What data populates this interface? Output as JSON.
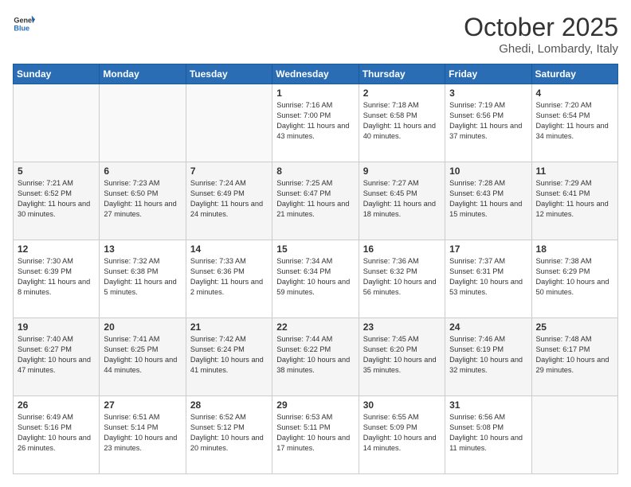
{
  "logo": {
    "general": "General",
    "blue": "Blue"
  },
  "header": {
    "month": "October 2025",
    "location": "Ghedi, Lombardy, Italy"
  },
  "weekdays": [
    "Sunday",
    "Monday",
    "Tuesday",
    "Wednesday",
    "Thursday",
    "Friday",
    "Saturday"
  ],
  "weeks": [
    [
      {
        "day": "",
        "sunrise": "",
        "sunset": "",
        "daylight": "",
        "empty": true
      },
      {
        "day": "",
        "sunrise": "",
        "sunset": "",
        "daylight": "",
        "empty": true
      },
      {
        "day": "",
        "sunrise": "",
        "sunset": "",
        "daylight": "",
        "empty": true
      },
      {
        "day": "1",
        "sunrise": "Sunrise: 7:16 AM",
        "sunset": "Sunset: 7:00 PM",
        "daylight": "Daylight: 11 hours and 43 minutes.",
        "empty": false
      },
      {
        "day": "2",
        "sunrise": "Sunrise: 7:18 AM",
        "sunset": "Sunset: 6:58 PM",
        "daylight": "Daylight: 11 hours and 40 minutes.",
        "empty": false
      },
      {
        "day": "3",
        "sunrise": "Sunrise: 7:19 AM",
        "sunset": "Sunset: 6:56 PM",
        "daylight": "Daylight: 11 hours and 37 minutes.",
        "empty": false
      },
      {
        "day": "4",
        "sunrise": "Sunrise: 7:20 AM",
        "sunset": "Sunset: 6:54 PM",
        "daylight": "Daylight: 11 hours and 34 minutes.",
        "empty": false
      }
    ],
    [
      {
        "day": "5",
        "sunrise": "Sunrise: 7:21 AM",
        "sunset": "Sunset: 6:52 PM",
        "daylight": "Daylight: 11 hours and 30 minutes.",
        "empty": false
      },
      {
        "day": "6",
        "sunrise": "Sunrise: 7:23 AM",
        "sunset": "Sunset: 6:50 PM",
        "daylight": "Daylight: 11 hours and 27 minutes.",
        "empty": false
      },
      {
        "day": "7",
        "sunrise": "Sunrise: 7:24 AM",
        "sunset": "Sunset: 6:49 PM",
        "daylight": "Daylight: 11 hours and 24 minutes.",
        "empty": false
      },
      {
        "day": "8",
        "sunrise": "Sunrise: 7:25 AM",
        "sunset": "Sunset: 6:47 PM",
        "daylight": "Daylight: 11 hours and 21 minutes.",
        "empty": false
      },
      {
        "day": "9",
        "sunrise": "Sunrise: 7:27 AM",
        "sunset": "Sunset: 6:45 PM",
        "daylight": "Daylight: 11 hours and 18 minutes.",
        "empty": false
      },
      {
        "day": "10",
        "sunrise": "Sunrise: 7:28 AM",
        "sunset": "Sunset: 6:43 PM",
        "daylight": "Daylight: 11 hours and 15 minutes.",
        "empty": false
      },
      {
        "day": "11",
        "sunrise": "Sunrise: 7:29 AM",
        "sunset": "Sunset: 6:41 PM",
        "daylight": "Daylight: 11 hours and 12 minutes.",
        "empty": false
      }
    ],
    [
      {
        "day": "12",
        "sunrise": "Sunrise: 7:30 AM",
        "sunset": "Sunset: 6:39 PM",
        "daylight": "Daylight: 11 hours and 8 minutes.",
        "empty": false
      },
      {
        "day": "13",
        "sunrise": "Sunrise: 7:32 AM",
        "sunset": "Sunset: 6:38 PM",
        "daylight": "Daylight: 11 hours and 5 minutes.",
        "empty": false
      },
      {
        "day": "14",
        "sunrise": "Sunrise: 7:33 AM",
        "sunset": "Sunset: 6:36 PM",
        "daylight": "Daylight: 11 hours and 2 minutes.",
        "empty": false
      },
      {
        "day": "15",
        "sunrise": "Sunrise: 7:34 AM",
        "sunset": "Sunset: 6:34 PM",
        "daylight": "Daylight: 10 hours and 59 minutes.",
        "empty": false
      },
      {
        "day": "16",
        "sunrise": "Sunrise: 7:36 AM",
        "sunset": "Sunset: 6:32 PM",
        "daylight": "Daylight: 10 hours and 56 minutes.",
        "empty": false
      },
      {
        "day": "17",
        "sunrise": "Sunrise: 7:37 AM",
        "sunset": "Sunset: 6:31 PM",
        "daylight": "Daylight: 10 hours and 53 minutes.",
        "empty": false
      },
      {
        "day": "18",
        "sunrise": "Sunrise: 7:38 AM",
        "sunset": "Sunset: 6:29 PM",
        "daylight": "Daylight: 10 hours and 50 minutes.",
        "empty": false
      }
    ],
    [
      {
        "day": "19",
        "sunrise": "Sunrise: 7:40 AM",
        "sunset": "Sunset: 6:27 PM",
        "daylight": "Daylight: 10 hours and 47 minutes.",
        "empty": false
      },
      {
        "day": "20",
        "sunrise": "Sunrise: 7:41 AM",
        "sunset": "Sunset: 6:25 PM",
        "daylight": "Daylight: 10 hours and 44 minutes.",
        "empty": false
      },
      {
        "day": "21",
        "sunrise": "Sunrise: 7:42 AM",
        "sunset": "Sunset: 6:24 PM",
        "daylight": "Daylight: 10 hours and 41 minutes.",
        "empty": false
      },
      {
        "day": "22",
        "sunrise": "Sunrise: 7:44 AM",
        "sunset": "Sunset: 6:22 PM",
        "daylight": "Daylight: 10 hours and 38 minutes.",
        "empty": false
      },
      {
        "day": "23",
        "sunrise": "Sunrise: 7:45 AM",
        "sunset": "Sunset: 6:20 PM",
        "daylight": "Daylight: 10 hours and 35 minutes.",
        "empty": false
      },
      {
        "day": "24",
        "sunrise": "Sunrise: 7:46 AM",
        "sunset": "Sunset: 6:19 PM",
        "daylight": "Daylight: 10 hours and 32 minutes.",
        "empty": false
      },
      {
        "day": "25",
        "sunrise": "Sunrise: 7:48 AM",
        "sunset": "Sunset: 6:17 PM",
        "daylight": "Daylight: 10 hours and 29 minutes.",
        "empty": false
      }
    ],
    [
      {
        "day": "26",
        "sunrise": "Sunrise: 6:49 AM",
        "sunset": "Sunset: 5:16 PM",
        "daylight": "Daylight: 10 hours and 26 minutes.",
        "empty": false
      },
      {
        "day": "27",
        "sunrise": "Sunrise: 6:51 AM",
        "sunset": "Sunset: 5:14 PM",
        "daylight": "Daylight: 10 hours and 23 minutes.",
        "empty": false
      },
      {
        "day": "28",
        "sunrise": "Sunrise: 6:52 AM",
        "sunset": "Sunset: 5:12 PM",
        "daylight": "Daylight: 10 hours and 20 minutes.",
        "empty": false
      },
      {
        "day": "29",
        "sunrise": "Sunrise: 6:53 AM",
        "sunset": "Sunset: 5:11 PM",
        "daylight": "Daylight: 10 hours and 17 minutes.",
        "empty": false
      },
      {
        "day": "30",
        "sunrise": "Sunrise: 6:55 AM",
        "sunset": "Sunset: 5:09 PM",
        "daylight": "Daylight: 10 hours and 14 minutes.",
        "empty": false
      },
      {
        "day": "31",
        "sunrise": "Sunrise: 6:56 AM",
        "sunset": "Sunset: 5:08 PM",
        "daylight": "Daylight: 10 hours and 11 minutes.",
        "empty": false
      },
      {
        "day": "",
        "sunrise": "",
        "sunset": "",
        "daylight": "",
        "empty": true
      }
    ]
  ]
}
